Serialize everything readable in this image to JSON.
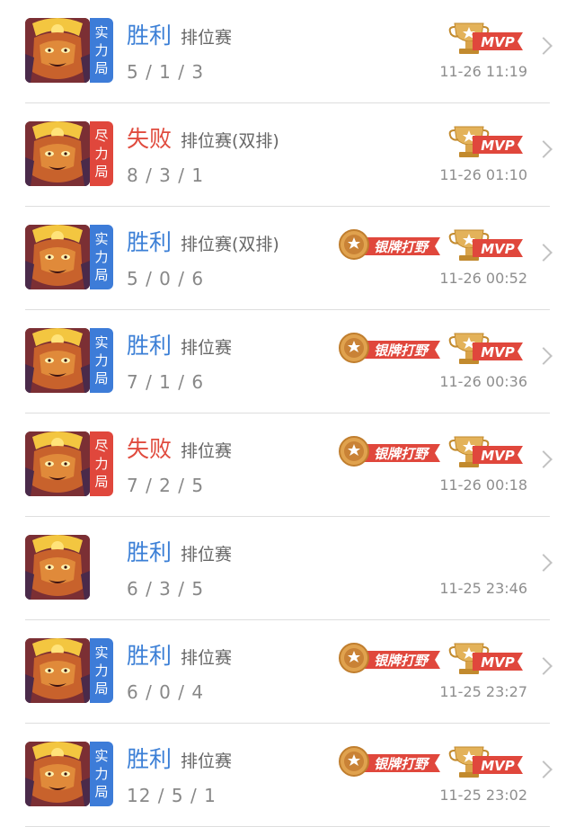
{
  "matches": [
    {
      "tag": [
        "实",
        "力",
        "局"
      ],
      "tag_color": "#3d7cd8",
      "result": "胜利",
      "outcome": "win",
      "mode": "排位赛",
      "kda": "5 / 1 / 3",
      "time": "11-26 11:19",
      "badge_silver": false,
      "badge_mvp": true
    },
    {
      "tag": [
        "尽",
        "力",
        "局"
      ],
      "tag_color": "#e0473c",
      "result": "失败",
      "outcome": "lose",
      "mode": "排位赛(双排)",
      "kda": "8 / 3 / 1",
      "time": "11-26 01:10",
      "badge_silver": false,
      "badge_mvp": true
    },
    {
      "tag": [
        "实",
        "力",
        "局"
      ],
      "tag_color": "#3d7cd8",
      "result": "胜利",
      "outcome": "win",
      "mode": "排位赛(双排)",
      "kda": "5 / 0 / 6",
      "time": "11-26 00:52",
      "badge_silver": true,
      "badge_mvp": true
    },
    {
      "tag": [
        "实",
        "力",
        "局"
      ],
      "tag_color": "#3d7cd8",
      "result": "胜利",
      "outcome": "win",
      "mode": "排位赛",
      "kda": "7 / 1 / 6",
      "time": "11-26 00:36",
      "badge_silver": true,
      "badge_mvp": true
    },
    {
      "tag": [
        "尽",
        "力",
        "局"
      ],
      "tag_color": "#e0473c",
      "result": "失败",
      "outcome": "lose",
      "mode": "排位赛",
      "kda": "7 / 2 / 5",
      "time": "11-26 00:18",
      "badge_silver": true,
      "badge_mvp": true
    },
    {
      "tag": [],
      "tag_color": "",
      "result": "胜利",
      "outcome": "win",
      "mode": "排位赛",
      "kda": "6 / 3 / 5",
      "time": "11-25 23:46",
      "badge_silver": false,
      "badge_mvp": false
    },
    {
      "tag": [
        "实",
        "力",
        "局"
      ],
      "tag_color": "#3d7cd8",
      "result": "胜利",
      "outcome": "win",
      "mode": "排位赛",
      "kda": "6 / 0 / 4",
      "time": "11-25 23:27",
      "badge_silver": true,
      "badge_mvp": true
    },
    {
      "tag": [
        "实",
        "力",
        "局"
      ],
      "tag_color": "#3d7cd8",
      "result": "胜利",
      "outcome": "win",
      "mode": "排位赛",
      "kda": "12 / 5 / 1",
      "time": "11-25 23:02",
      "badge_silver": true,
      "badge_mvp": true
    }
  ],
  "badges": {
    "mvp_label": "MVP",
    "silver_label": "银牌打野"
  },
  "icons": {
    "hero": "hero-avatar-icon",
    "mvp": "mvp-trophy-icon",
    "silver": "silver-jungle-medal-icon",
    "chevron": "chevron-right-icon"
  },
  "colors": {
    "win": "#3b7fd6",
    "lose": "#e04b3e",
    "badge_red": "#e0473c",
    "gold": "#d9a34a"
  }
}
